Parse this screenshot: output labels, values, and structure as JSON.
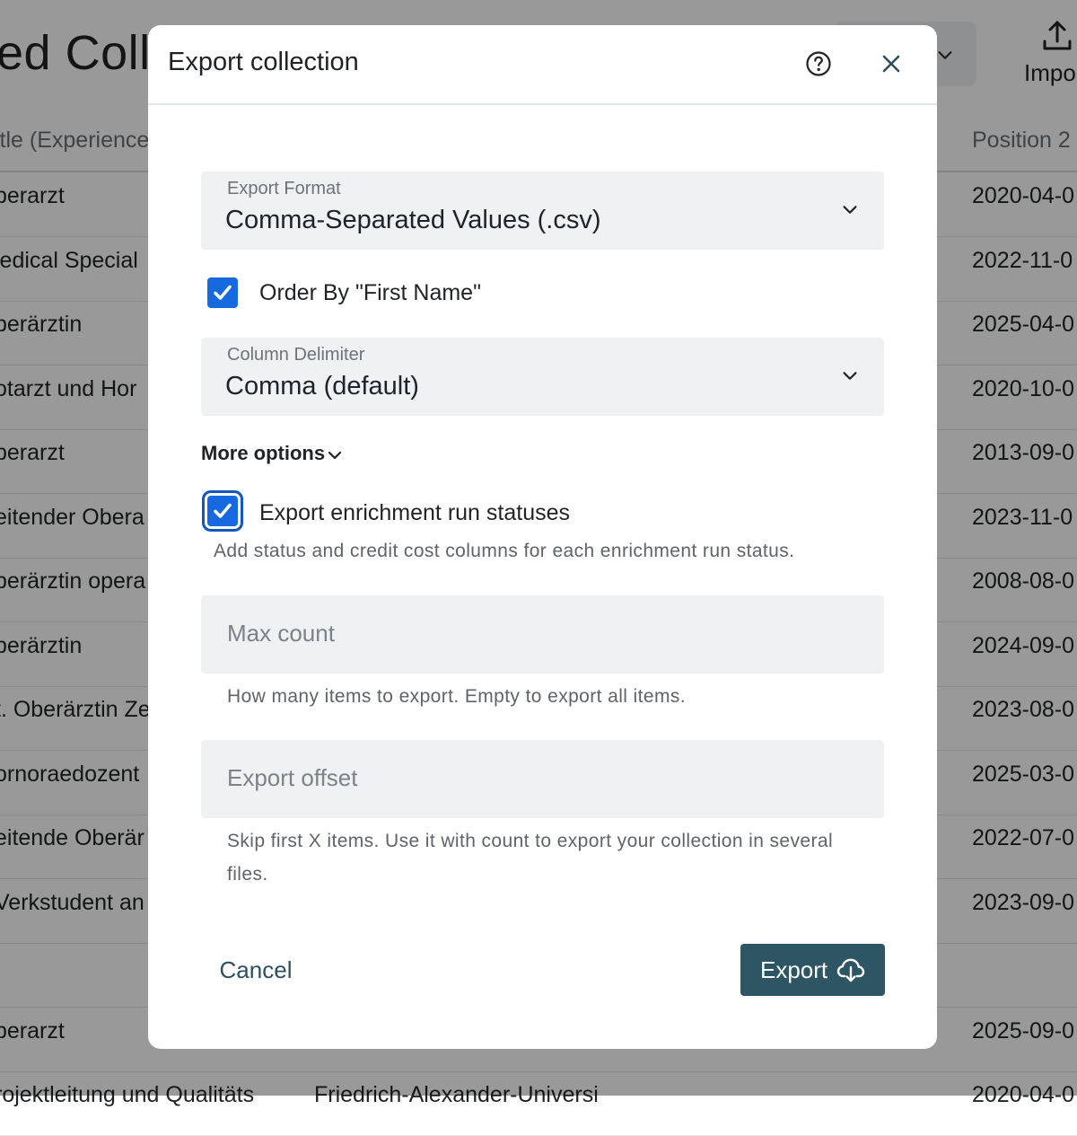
{
  "background": {
    "page_title": "ed Colle",
    "import_label": "Impo",
    "col_left_header": "itle (Experience",
    "col_right_header": "Position 2",
    "rows": [
      {
        "title": "berarzt",
        "org": "",
        "date": "2020-04-0"
      },
      {
        "title": "ledical Special",
        "org": "",
        "date": "2022-11-0"
      },
      {
        "title": "berärztin",
        "org": "",
        "date": "2025-04-0"
      },
      {
        "title": "otarzt und Hor",
        "org": "",
        "date": "2020-10-0"
      },
      {
        "title": "berarzt",
        "org": "",
        "date": "2013-09-0"
      },
      {
        "title": "eitender Obera",
        "org": "",
        "date": "2023-11-0"
      },
      {
        "title": "berärztin opera",
        "org": "",
        "date": "2008-08-0"
      },
      {
        "title": "berärztin",
        "org": "",
        "date": "2024-09-0"
      },
      {
        "title": "t. Oberärztin Ze",
        "org": "",
        "date": "2023-08-0"
      },
      {
        "title": "ornoraedozent",
        "org": "",
        "date": "2025-03-0"
      },
      {
        "title": "eitende Oberär",
        "org": "",
        "date": "2022-07-0"
      },
      {
        "title": "Verkstudent an",
        "org": "",
        "date": "2023-09-0"
      },
      {
        "title": "",
        "org": "",
        "date": ""
      },
      {
        "title": "berarzt",
        "org": "",
        "date": "2025-09-0"
      },
      {
        "title": "rojektleitung und Qualitäts",
        "org": "Friedrich-Alexander-Universi",
        "date": "2020-04-0"
      }
    ]
  },
  "modal": {
    "title": "Export collection",
    "export_format": {
      "label": "Export Format",
      "value": "Comma-Separated Values (.csv)"
    },
    "order_by": {
      "label": "Order By \"First Name\"",
      "checked": true
    },
    "column_delimiter": {
      "label": "Column Delimiter",
      "value": "Comma (default)"
    },
    "more_options_label": "More options",
    "enrichment": {
      "label": "Export enrichment run statuses",
      "checked": true,
      "helper": "Add status and credit cost columns for each enrichment run status."
    },
    "max_count": {
      "placeholder": "Max count",
      "value": "",
      "helper": "How many items to export. Empty to export all items."
    },
    "export_offset": {
      "placeholder": "Export offset",
      "value": "",
      "helper": "Skip first X items. Use it with count to export your collection in several files."
    },
    "cancel_label": "Cancel",
    "export_label": "Export"
  },
  "icons": {
    "help": "help-circle-icon",
    "close": "close-icon",
    "chevron": "chevron-down-icon",
    "check": "check-icon",
    "upload": "upload-icon",
    "cloud_download": "cloud-download-icon"
  },
  "colors": {
    "accent": "#1769e0",
    "primary_button": "#2d5563",
    "overlay": "rgba(0,0,0,0.40)"
  }
}
